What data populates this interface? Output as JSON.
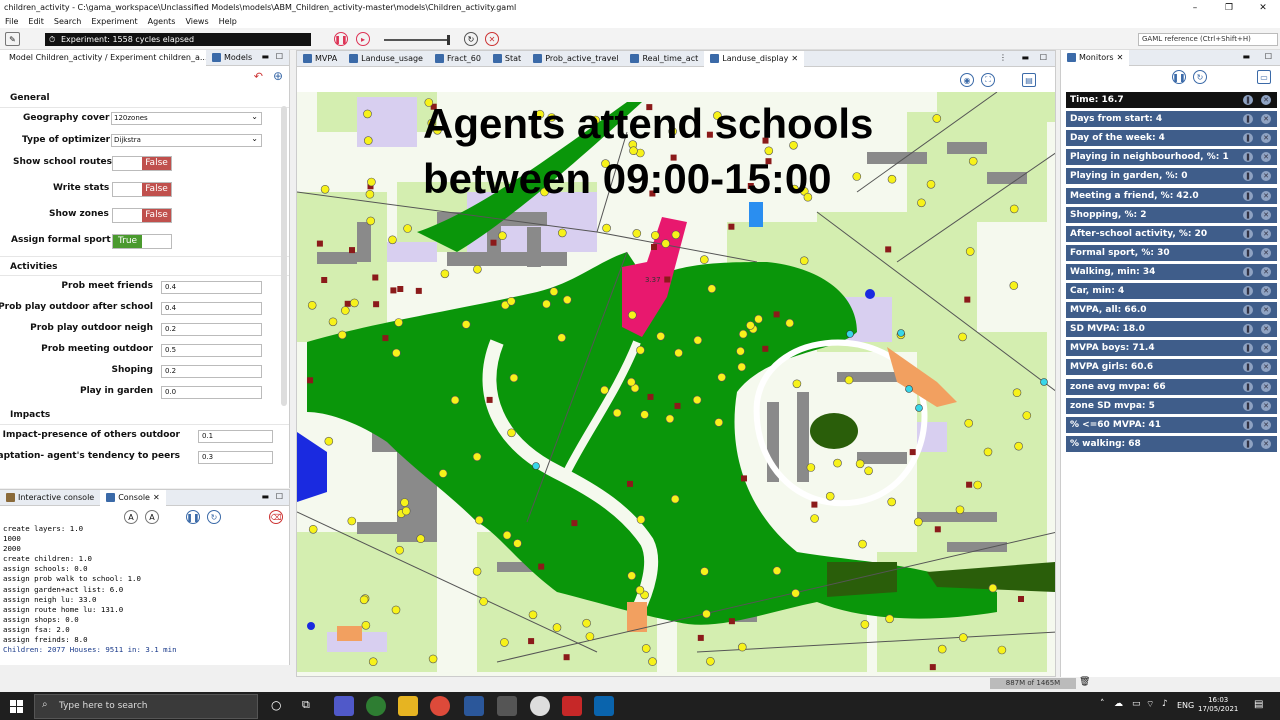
{
  "window": {
    "title": "children_activity - C:\\gama_workspace\\Unclassified Models\\models\\ABM_Children_activity-master\\models\\Children_activity.gaml"
  },
  "menu": [
    "File",
    "Edit",
    "Search",
    "Experiment",
    "Agents",
    "Views",
    "Help"
  ],
  "toolbar": {
    "experiment_status": "Experiment: 1558 cycles elapsed",
    "gaml_reference_placeholder": "GAML reference (Ctrl+Shift+H)"
  },
  "left_tabs": {
    "params": "Model Children_activity / Experiment children_a...",
    "models": "Models"
  },
  "general": {
    "title": "General",
    "geography_label": "Geography cover",
    "geography_value": "120zones",
    "optimizer_label": "Type of optimizer",
    "optimizer_value": "Dijkstra",
    "school_routes_label": "Show school routes",
    "school_routes_value": "False",
    "write_stats_label": "Write stats",
    "write_stats_value": "False",
    "zones_label": "Show zones",
    "zones_value": "False",
    "formal_sport_label": "Assign formal sport",
    "formal_sport_value": "True"
  },
  "activities": {
    "title": "Activities",
    "rows": [
      {
        "label": "Prob meet friends",
        "value": "0.4"
      },
      {
        "label": "Prob play outdoor after school",
        "value": "0.4"
      },
      {
        "label": "Prob play outdoor neigh",
        "value": "0.2"
      },
      {
        "label": "Prob meeting outdoor",
        "value": "0.5"
      },
      {
        "label": "Shoping",
        "value": "0.2"
      },
      {
        "label": "Play in garden",
        "value": "0.0"
      }
    ]
  },
  "impacts": {
    "title": "Impacts",
    "rows": [
      {
        "label": "Impact-presence of others outdoor",
        "value": "0.1"
      },
      {
        "label": "Adaptation- agent's tendency to peers",
        "value": "0.3"
      }
    ]
  },
  "console_tabs": {
    "interactive": "Interactive console",
    "console": "Console"
  },
  "console_lines": [
    "create layers: 1.0",
    "1000",
    "2000",
    "create children: 1.0",
    "assign schools: 0.0",
    "assign prob walk to school: 1.0",
    "assign garden+act list: 6.0",
    "assign neigh lu: 33.0",
    "assign route home lu: 131.0",
    "assign shops: 0.0",
    "assign fsa: 2.0",
    "assign freinds: 8.0"
  ],
  "console_summary": "Children: 2077 Houses: 9511 in: 3.1 min",
  "display_tabs": [
    "MVPA",
    "Landuse_usage",
    "Fract_60",
    "Stat",
    "Prob_active_travel",
    "Real_time_act",
    "Landuse_display"
  ],
  "map": {
    "overlay_line1": "Agents attend schools",
    "overlay_line2": "between 09:00-15:00",
    "school_label": "3.37"
  },
  "monitors_tab": "Monitors",
  "monitors": [
    "Time:  16.7",
    "Days from start:  4",
    "Day of the week:  4",
    "Playing in neighbourhood, %:  1",
    "Playing in garden, %:  0",
    "Meeting a friend, %:  42.0",
    "Shopping, %:  2",
    "After-school activity, %:  20",
    "Formal sport, %:  30",
    "Walking, min:  34",
    "Car, min:  4",
    "MVPA, all:  66.0",
    "SD MVPA:  18.0",
    "MVPA boys:  71.4",
    "MVPA girls:  60.6",
    "zone avg mvpa:  66",
    "zone SD mvpa:  5",
    "% <=60 MVPA:  41",
    "% walking:  68"
  ],
  "status": {
    "memory": "887M of 1465M"
  },
  "taskbar": {
    "search_placeholder": "Type here to search",
    "lang": "ENG",
    "time": "16:03",
    "date": "17/05/2021"
  },
  "colors": {
    "park": "#0a960a",
    "monitor_bg": "#3f5d8a",
    "school": "#e8186e",
    "false_badge": "#c0504d",
    "true_badge": "#4a9a2e"
  }
}
